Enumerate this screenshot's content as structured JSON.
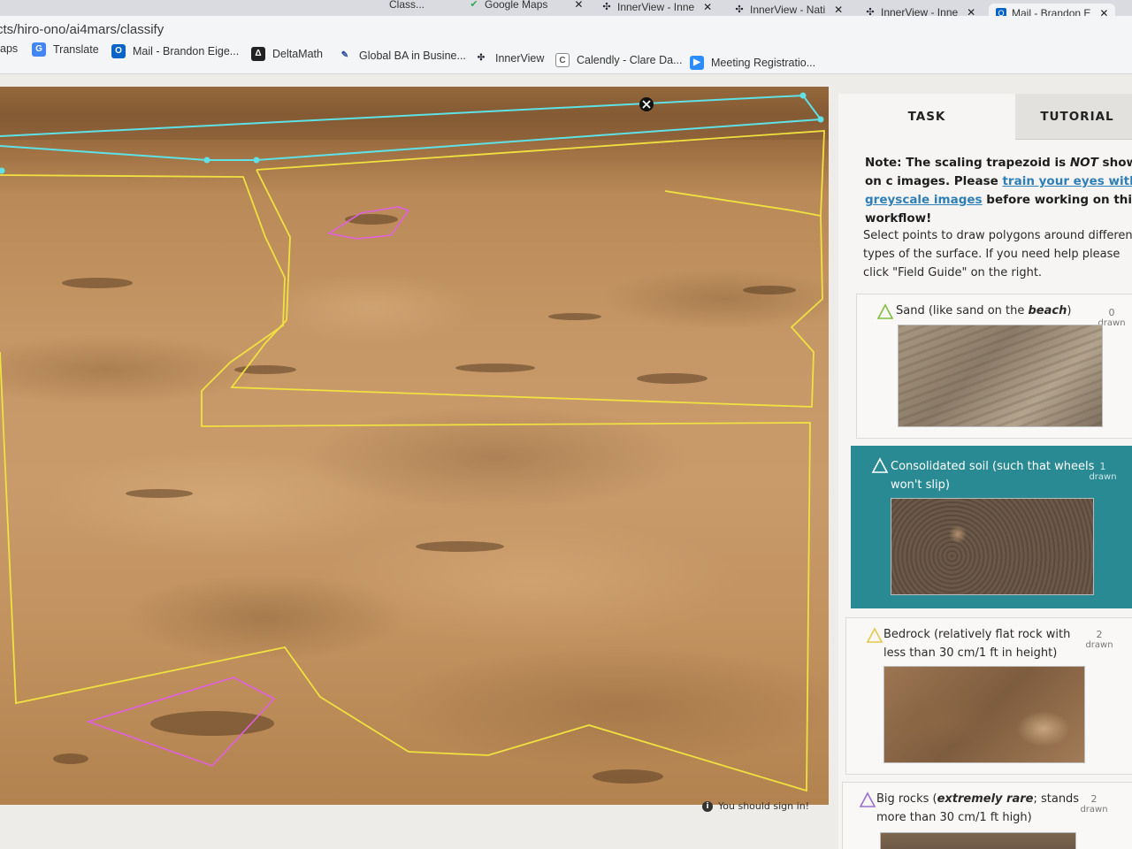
{
  "browser": {
    "tabs": [
      {
        "label": "Class..."
      },
      {
        "label": "Google Maps"
      },
      {
        "label": "InnerView - Inne"
      },
      {
        "label": "InnerView - Nati"
      },
      {
        "label": "InnerView - Inne"
      },
      {
        "label": "Mail - Brandon E"
      }
    ],
    "url": "cts/hiro-ono/ai4mars/classify",
    "bookmarks": [
      {
        "label": "aps"
      },
      {
        "label": "Translate"
      },
      {
        "label": "Mail - Brandon Eige..."
      },
      {
        "label": "DeltaMath"
      },
      {
        "label": "Global BA in Busine..."
      },
      {
        "label": "InnerView"
      },
      {
        "label": "Calendly - Clare Da..."
      },
      {
        "label": "Meeting Registratio..."
      }
    ]
  },
  "image": {
    "sign_in_notice": "You should sign in!"
  },
  "panel": {
    "tabs": {
      "task": "TASK",
      "tutorial": "TUTORIAL"
    },
    "note": {
      "prefix": "Note: The scaling trapezoid is ",
      "emphasis": "NOT",
      "middle": " shown on c images. Please ",
      "link": "train your eyes with greyscale images",
      "suffix": " before working on this workflow!"
    },
    "instructions": "Select points to draw polygons around different types of the surface. If you need help please click \"Field Guide\" on the right.",
    "choices": [
      {
        "label_a": "Sand (like sand on the ",
        "label_b": "beach",
        "label_c": ")",
        "count": "0",
        "count_label": "drawn",
        "icon_color": "#7fbf3f"
      },
      {
        "label_a": "Consolidated soil (such that wheels won't slip)",
        "label_b": "",
        "label_c": "",
        "count": "1",
        "count_label": "drawn",
        "icon_color": "#ffffff"
      },
      {
        "label_a": "Bedrock (relatively flat rock with less than 30 cm/1 ft in height)",
        "label_b": "",
        "label_c": "",
        "count": "2",
        "count_label": "drawn",
        "icon_color": "#e6c84a"
      },
      {
        "label_a": "Big rocks (",
        "label_b": "extremely rare",
        "label_c": "; stands more than 30 cm/1 ft high)",
        "count": "2",
        "count_label": "drawn",
        "icon_color": "#9a6fd0"
      }
    ]
  },
  "colors": {
    "selected_choice": "#2a8a94",
    "polygon_cyan": "#5fe1e6",
    "polygon_yellow": "#f0e040",
    "polygon_magenta": "#e060e0"
  }
}
